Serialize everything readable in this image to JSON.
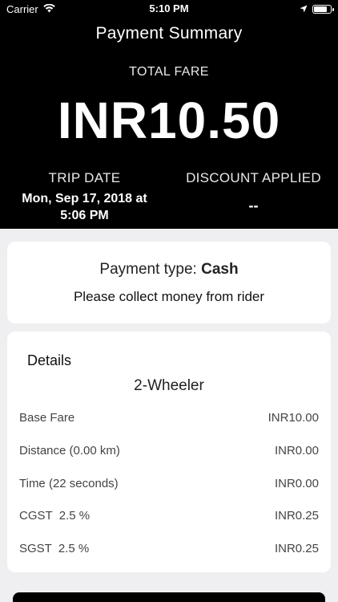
{
  "status_bar": {
    "carrier": "Carrier",
    "time": "5:10 PM",
    "battery_level": 0.85
  },
  "header": {
    "title": "Payment Summary",
    "total_fare_label": "TOTAL FARE",
    "total_fare_value": "INR10.50",
    "trip_date_label": "TRIP DATE",
    "trip_date_value": "Mon, Sep 17, 2018 at 5:06 PM",
    "discount_label": "DISCOUNT APPLIED",
    "discount_value": "--"
  },
  "payment": {
    "type_prefix": "Payment type: ",
    "type_value": "Cash",
    "note": "Please collect money from rider"
  },
  "details": {
    "title": "Details",
    "vehicle_type": "2-Wheeler",
    "rows": [
      {
        "label": "Base Fare",
        "amount": "INR10.00"
      },
      {
        "label": "Distance (0.00 km)",
        "amount": "INR0.00"
      },
      {
        "label": "Time (22 seconds)",
        "amount": "INR0.00"
      },
      {
        "label": "CGST  2.5 %",
        "amount": "INR0.25"
      },
      {
        "label": "SGST  2.5 %",
        "amount": "INR0.25"
      }
    ]
  },
  "colors": {
    "header_bg": "#000000",
    "page_bg": "#efeff2",
    "card_bg": "#ffffff"
  }
}
